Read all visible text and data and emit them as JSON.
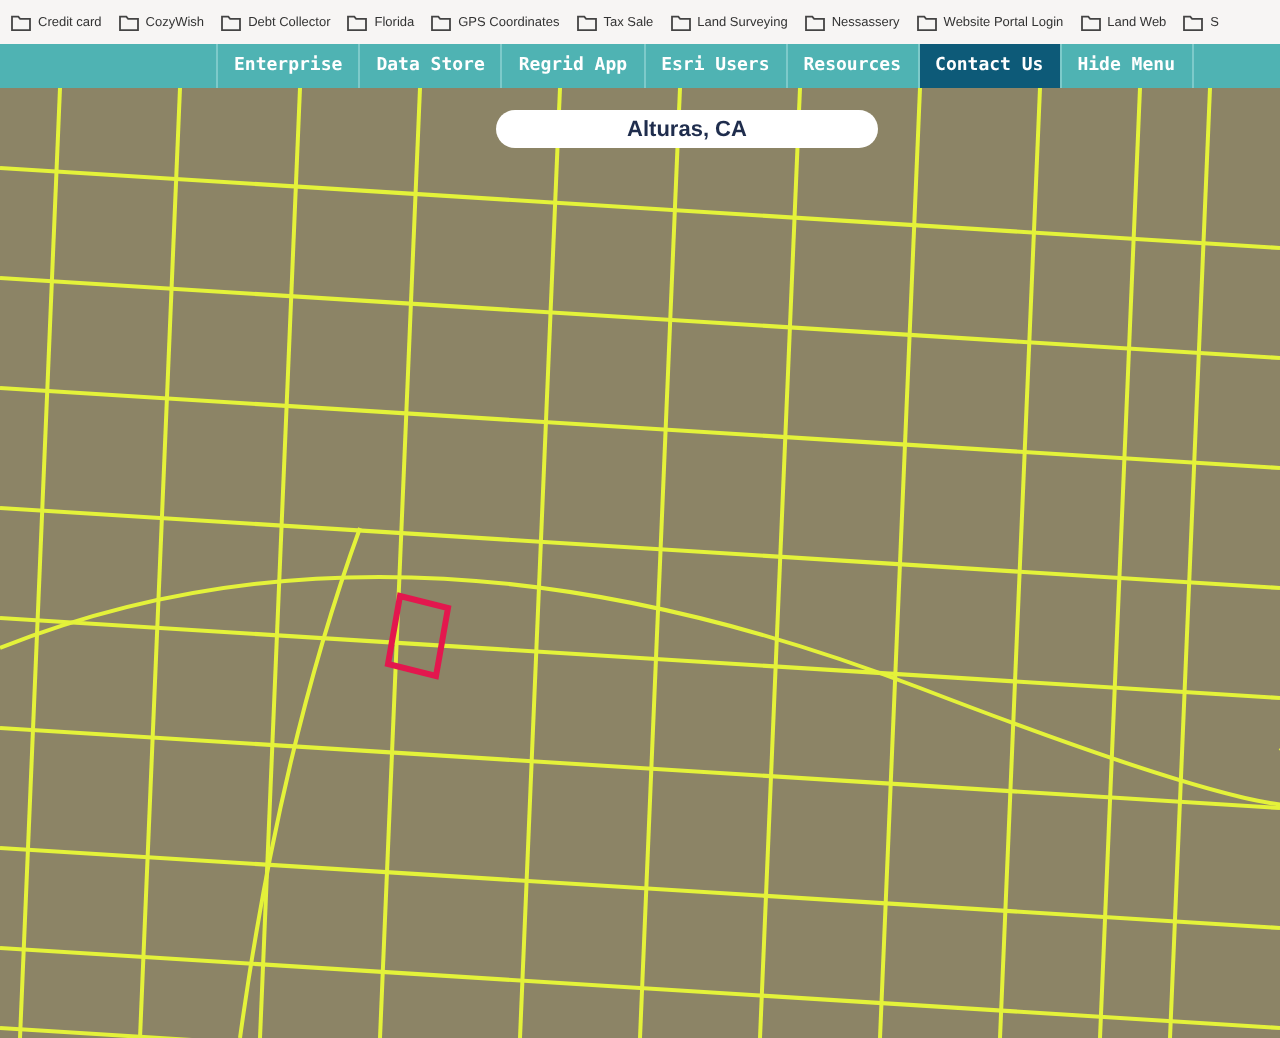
{
  "bookmarks": [
    "Credit card",
    "CozyWish",
    "Debt Collector",
    "Florida",
    "GPS Coordinates",
    "Tax Sale",
    "Land Surveying",
    "Nessassery",
    "Website Portal Login",
    "Land Web",
    "S"
  ],
  "nav": [
    {
      "label": "Enterprise",
      "selected": false
    },
    {
      "label": "Data Store",
      "selected": false
    },
    {
      "label": "Regrid App",
      "selected": false
    },
    {
      "label": "Esri Users",
      "selected": false
    },
    {
      "label": "Resources",
      "selected": false
    },
    {
      "label": "Contact Us",
      "selected": true
    },
    {
      "label": "Hide Menu",
      "selected": false
    }
  ],
  "map": {
    "location": "Alturas, CA"
  }
}
